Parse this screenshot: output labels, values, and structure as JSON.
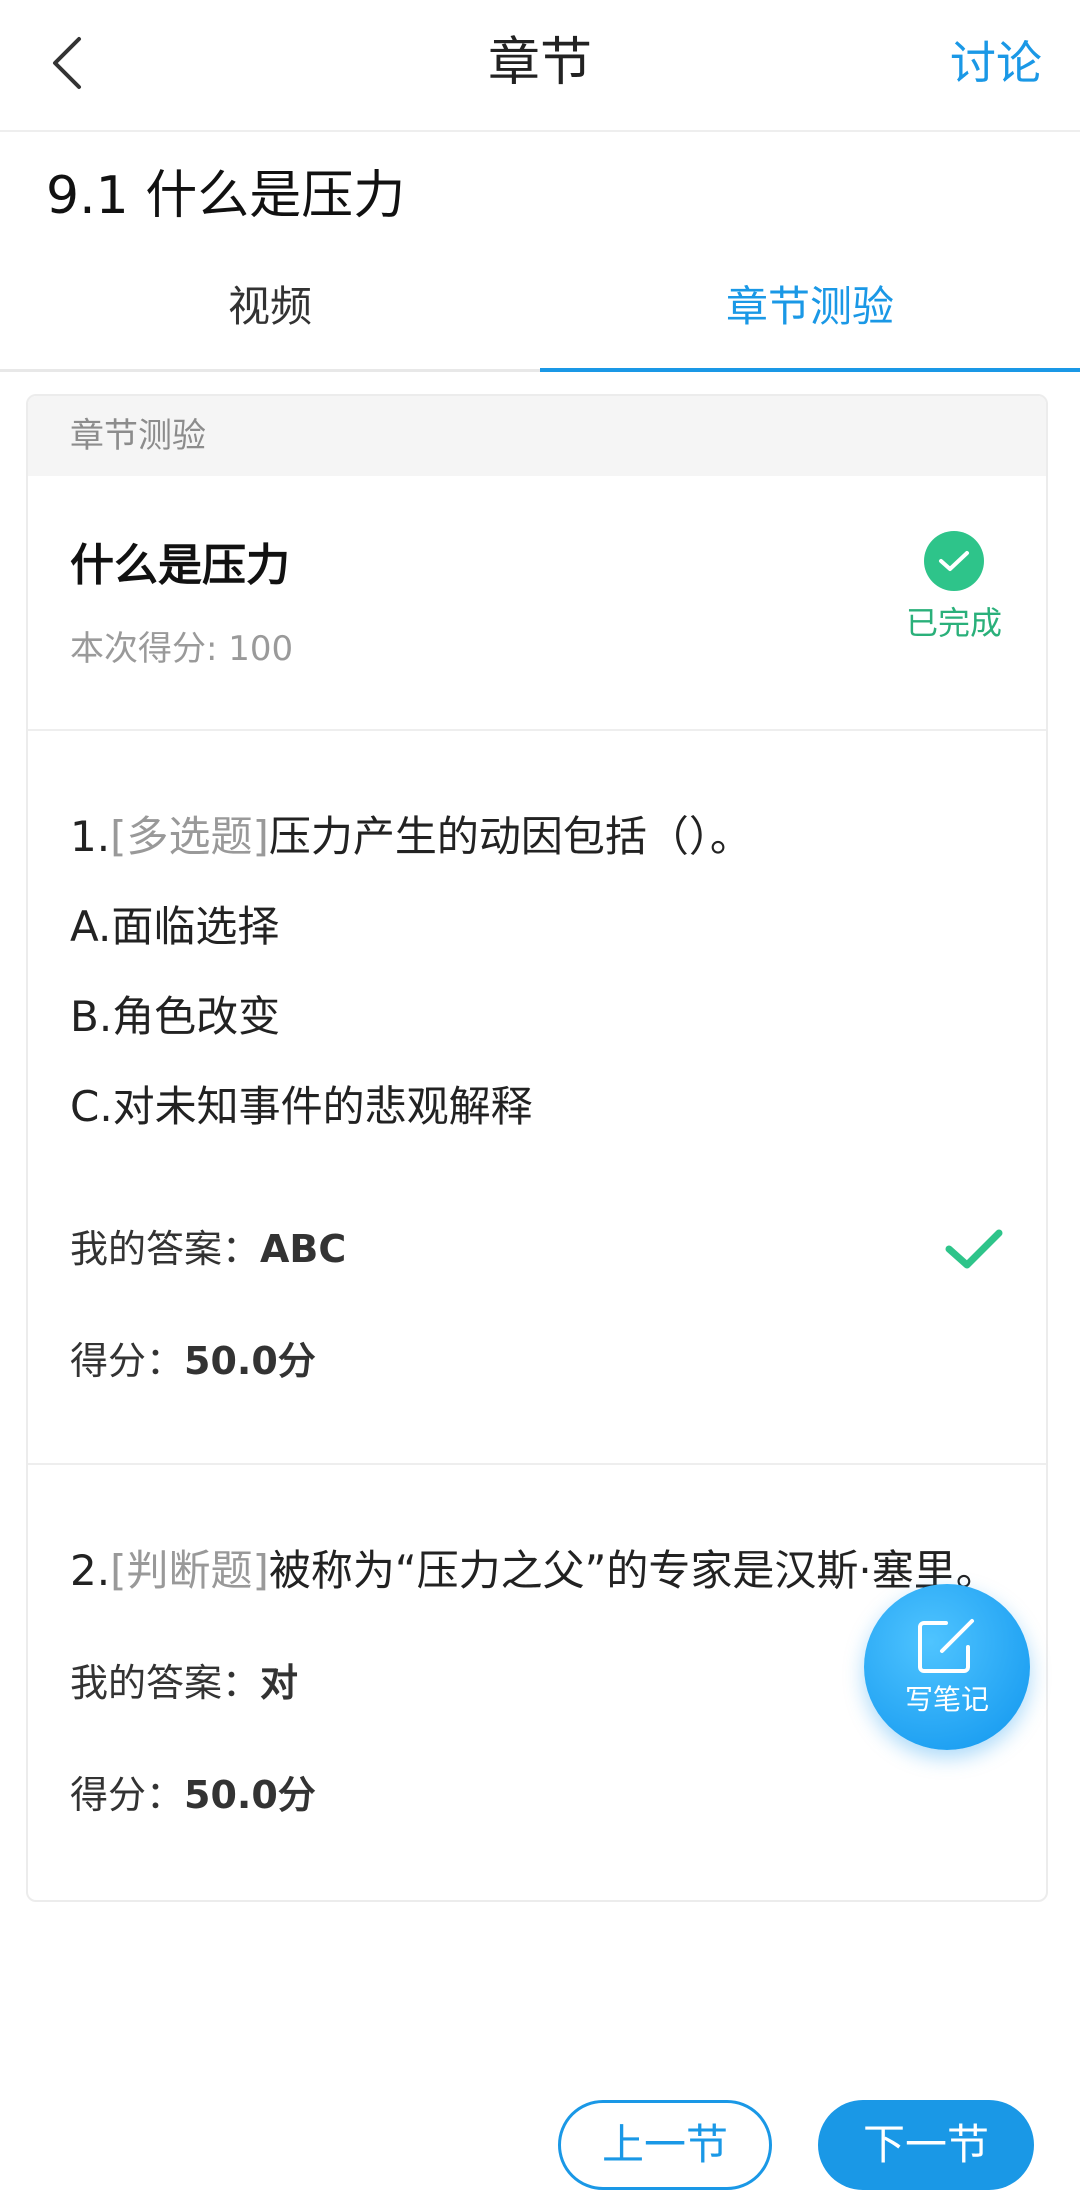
{
  "header": {
    "title": "章节",
    "discuss_label": "讨论"
  },
  "section": {
    "title": "9.1 什么是压力"
  },
  "tabs": [
    {
      "label": "视频",
      "active": false
    },
    {
      "label": "章节测验",
      "active": true
    }
  ],
  "quiz": {
    "card_header": "章节测验",
    "name": "什么是压力",
    "score_text": "本次得分: 100",
    "status": "已完成"
  },
  "questions": [
    {
      "number": "1.",
      "type": "[多选题]",
      "stem": "压力产生的动因包括（）。",
      "options": [
        "A.面临选择",
        "B.角色改变",
        "C.对未知事件的悲观解释"
      ],
      "answer_label": "我的答案：",
      "answer_value": "ABC",
      "score_label": "得分：",
      "score_value": "50.0分",
      "correct": true
    },
    {
      "number": "2.",
      "type": "[判断题]",
      "stem": "被称为“压力之父”的专家是汉斯·塞里。",
      "options": [],
      "answer_label": "我的答案：",
      "answer_value": "对",
      "score_label": "得分：",
      "score_value": "50.0分",
      "correct": false
    }
  ],
  "note_fab": {
    "label": "写笔记"
  },
  "nav": {
    "prev_label": "上一节",
    "next_label": "下一节"
  },
  "colors": {
    "accent": "#1a98e6",
    "success": "#2ec48a",
    "muted": "#999999"
  }
}
